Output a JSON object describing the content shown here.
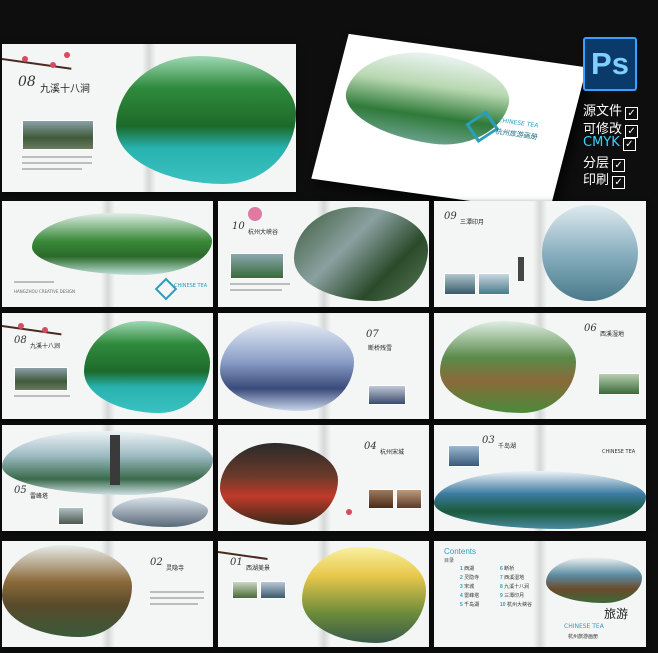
{
  "app": {
    "badge_text": "Ps"
  },
  "features": [
    {
      "label": "源文件",
      "check": "✓"
    },
    {
      "label": "可修改",
      "check": "✓"
    },
    {
      "label": "CMYK",
      "check": "✓"
    },
    {
      "label": "分层",
      "check": "✓"
    },
    {
      "label": "印刷",
      "check": "✓"
    }
  ],
  "colors": {
    "accent_teal": "#2aa0b8",
    "ps_blue": "#0a3a6a",
    "plum": "#d84a5e",
    "cmyk": "#3fd0ff"
  },
  "cover": {
    "en_title": "CHINESE TEA",
    "cn_title": "杭州旅游画册"
  },
  "hero": {
    "num": "08",
    "title": "九溪十八涧"
  },
  "spreads": [
    {
      "num": "",
      "title": "",
      "logo": "CHINESE TEA",
      "credit": "HANGZHOU CREATIVE DESIGN"
    },
    {
      "num": "10",
      "title": "杭州大峡谷"
    },
    {
      "num": "09",
      "title": "三潭印月"
    },
    {
      "num": "08",
      "title": "九溪十八涧"
    },
    {
      "num": "07",
      "title": "断桥残雪"
    },
    {
      "num": "06",
      "title": "西溪湿地"
    },
    {
      "num": "05",
      "title": "雷峰塔"
    },
    {
      "num": "04",
      "title": "杭州宋城"
    },
    {
      "num": "03",
      "title": "千岛湖"
    },
    {
      "num": "02",
      "title": "灵隐寺"
    },
    {
      "num": "01",
      "title": "西湖美景"
    }
  ],
  "contents": {
    "heading": "Contents",
    "sub": "目录",
    "items": [
      {
        "n": "1",
        "t": "西湖"
      },
      {
        "n": "2",
        "t": "灵隐寺"
      },
      {
        "n": "3",
        "t": "宋城"
      },
      {
        "n": "4",
        "t": "雷峰塔"
      },
      {
        "n": "5",
        "t": "千岛湖"
      },
      {
        "n": "6",
        "t": "断桥"
      },
      {
        "n": "7",
        "t": "西溪湿地"
      },
      {
        "n": "8",
        "t": "九溪十八涧"
      },
      {
        "n": "9",
        "t": "三潭印月"
      },
      {
        "n": "10",
        "t": "杭州大峡谷"
      }
    ],
    "stamp": "旅游",
    "brand_en": "CHINESE TEA",
    "brand_cn": "杭州旅游画册"
  }
}
